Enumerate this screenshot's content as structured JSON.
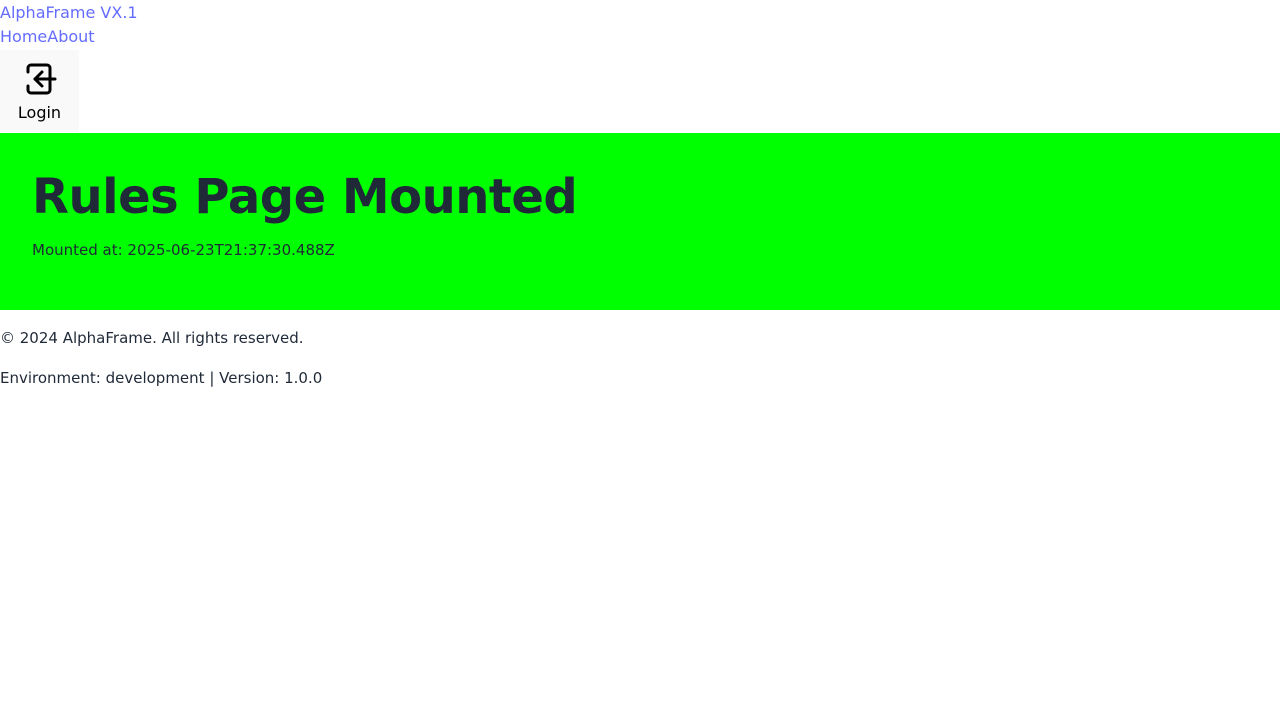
{
  "header": {
    "brand": "AlphaFrame VX.1",
    "nav": {
      "home": "Home",
      "about": "About"
    },
    "login_label": "Login",
    "login_icon": "login-arrow-icon"
  },
  "banner": {
    "title": "Rules Page Mounted",
    "mounted_at": "Mounted at: 2025-06-23T21:37:30.488Z",
    "background_color": "#00ff00"
  },
  "footer": {
    "copyright": "© 2024 AlphaFrame. All rights reserved.",
    "environment": "Environment: development | Version: 1.0.0"
  },
  "colors": {
    "link": "#646cff",
    "text": "#1f2937",
    "login_bg": "#f9f9f9"
  }
}
